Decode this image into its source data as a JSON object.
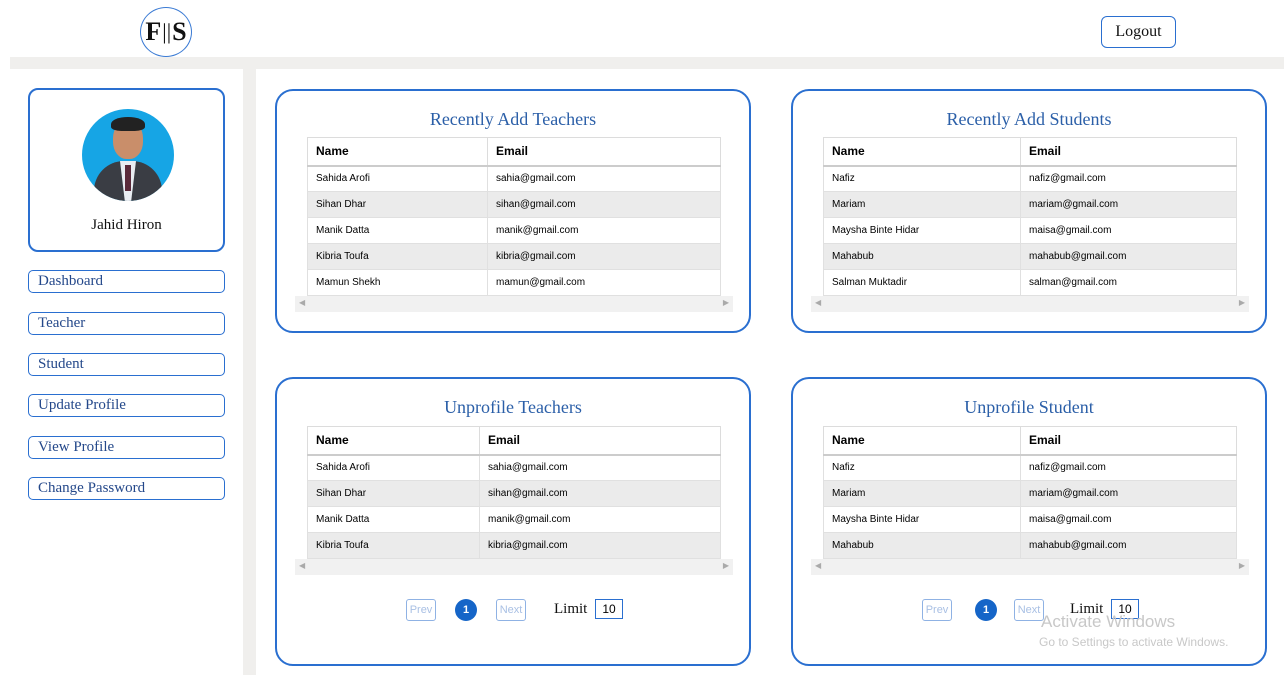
{
  "header": {
    "logo_left": "F",
    "logo_sep": "||",
    "logo_right": "S",
    "logout_label": "Logout"
  },
  "sidebar": {
    "profile_name": "Jahid Hiron",
    "items": [
      {
        "label": "Dashboard"
      },
      {
        "label": "Teacher"
      },
      {
        "label": "Student"
      },
      {
        "label": "Update Profile"
      },
      {
        "label": "View Profile"
      },
      {
        "label": "Change Password"
      }
    ]
  },
  "cards": {
    "recent_teachers": {
      "title": "Recently Add Teachers",
      "columns": [
        "Name",
        "Email"
      ],
      "rows": [
        [
          "Sahida Arofi",
          "sahia@gmail.com"
        ],
        [
          "Sihan Dhar",
          "sihan@gmail.com"
        ],
        [
          "Manik Datta",
          "manik@gmail.com"
        ],
        [
          "Kibria Toufa",
          "kibria@gmail.com"
        ],
        [
          "Mamun Shekh",
          "mamun@gmail.com"
        ]
      ]
    },
    "recent_students": {
      "title": "Recently Add Students",
      "columns": [
        "Name",
        "Email"
      ],
      "rows": [
        [
          "Nafiz",
          "nafiz@gmail.com"
        ],
        [
          "Mariam",
          "mariam@gmail.com"
        ],
        [
          "Maysha Binte Hidar",
          "maisa@gmail.com"
        ],
        [
          "Mahabub",
          "mahabub@gmail.com"
        ],
        [
          "Salman Muktadir",
          "salman@gmail.com"
        ]
      ]
    },
    "unprofile_teachers": {
      "title": "Unprofile Teachers",
      "columns": [
        "Name",
        "Email"
      ],
      "rows": [
        [
          "Sahida Arofi",
          "sahia@gmail.com"
        ],
        [
          "Sihan Dhar",
          "sihan@gmail.com"
        ],
        [
          "Manik Datta",
          "manik@gmail.com"
        ],
        [
          "Kibria Toufa",
          "kibria@gmail.com"
        ]
      ],
      "pager": {
        "prev": "Prev",
        "page": "1",
        "next": "Next",
        "limit_label": "Limit",
        "limit": "10"
      }
    },
    "unprofile_students": {
      "title": "Unprofile Student",
      "columns": [
        "Name",
        "Email"
      ],
      "rows": [
        [
          "Nafiz",
          "nafiz@gmail.com"
        ],
        [
          "Mariam",
          "mariam@gmail.com"
        ],
        [
          "Maysha Binte Hidar",
          "maisa@gmail.com"
        ],
        [
          "Mahabub",
          "mahabub@gmail.com"
        ]
      ],
      "pager": {
        "prev": "Prev",
        "page": "1",
        "next": "Next",
        "limit_label": "Limit",
        "limit": "10"
      }
    }
  },
  "watermark": {
    "line1": "Activate Windows",
    "line2": "Go to Settings to activate Windows."
  },
  "colors": {
    "accent": "#2a6fd0",
    "title": "#2b5fa8",
    "page_active": "#1565c8",
    "avatar_bg": "#16a5e5"
  }
}
